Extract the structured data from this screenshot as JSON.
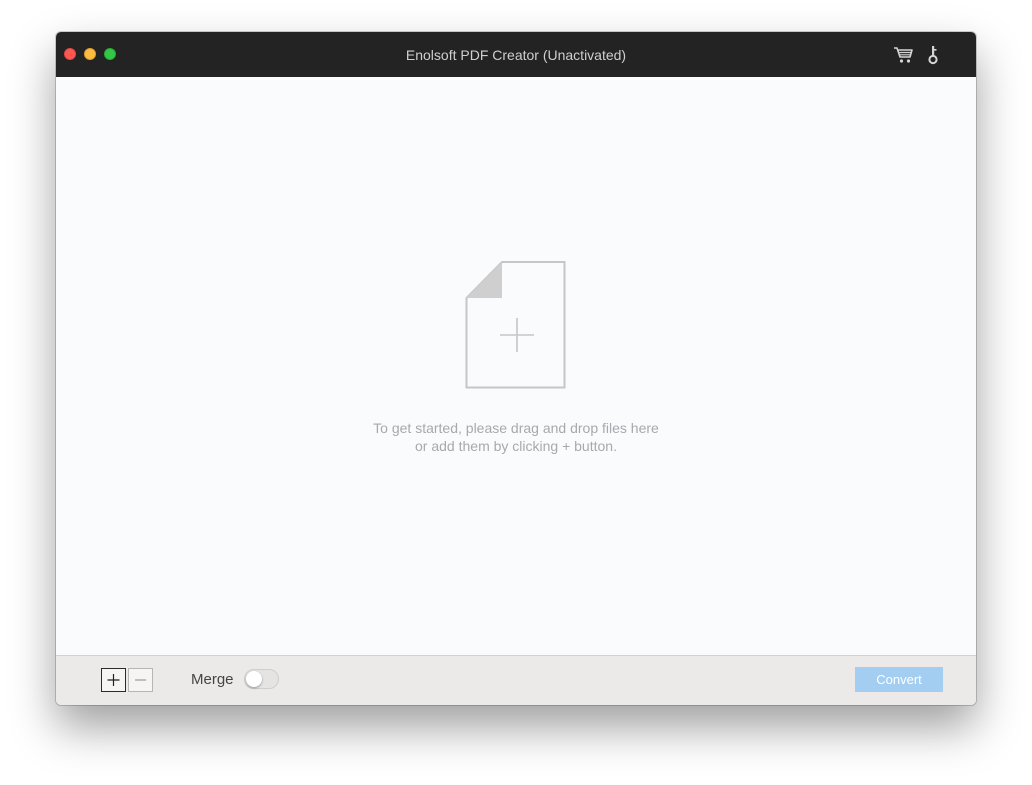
{
  "window": {
    "title": "Enolsoft PDF Creator (Unactivated)"
  },
  "titlebar": {
    "icons": [
      "cart-icon",
      "key-icon"
    ]
  },
  "main": {
    "drop_icon": "add-file-icon",
    "hint_line1": "To get started, please drag and drop files here",
    "hint_line2": "or add them by clicking + button."
  },
  "bottombar": {
    "add_label": "+",
    "remove_label": "–",
    "merge_label": "Merge",
    "merge_enabled": false,
    "convert_label": "Convert"
  },
  "colors": {
    "titlebar_bg": "#232323",
    "content_bg": "#fafbfd",
    "bottombar_bg": "#eceae8",
    "convert_bg": "#a3cef1",
    "hint_text": "#a6a9ad"
  }
}
